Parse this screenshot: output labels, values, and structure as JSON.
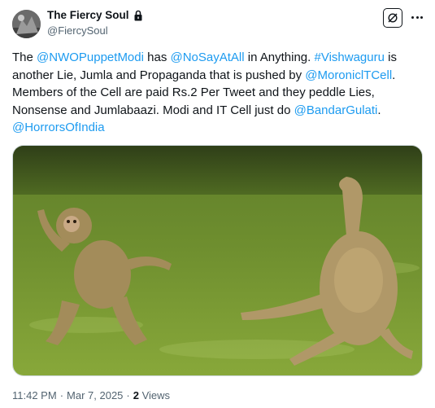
{
  "author": {
    "display_name": "The Fiercy Soul",
    "handle": "@FiercySoul",
    "avatar_icon": "avatar-photo",
    "protected_icon": "lock-icon"
  },
  "header_actions": {
    "grok_icon": "grok-icon",
    "more_icon": "more-options-icon"
  },
  "tweet": {
    "segments": [
      {
        "text": "The ",
        "type": "text"
      },
      {
        "text": "@NWOPuppetModi",
        "type": "link"
      },
      {
        "text": " has ",
        "type": "text"
      },
      {
        "text": "@NoSayAtAll",
        "type": "link"
      },
      {
        "text": " in Anything. ",
        "type": "text"
      },
      {
        "text": "#Vishwaguru",
        "type": "link"
      },
      {
        "text": " is another Lie, Jumla and Propaganda that is pushed by ",
        "type": "text"
      },
      {
        "text": "@MoroniclTCell",
        "type": "link"
      },
      {
        "text": ". Members of the Cell are paid Rs.2 Per Tweet  and they peddle Lies, Nonsense and Jumlabaazi. Modi and IT Cell just do ",
        "type": "text"
      },
      {
        "text": "@BandarGulati",
        "type": "link"
      },
      {
        "text": ". ",
        "type": "text"
      },
      {
        "text": "@HorrorsOfIndia",
        "type": "link"
      }
    ]
  },
  "media": {
    "description_icon": "photo-two-monkeys-on-grass"
  },
  "meta": {
    "time": "11:42 PM",
    "sep1": "·",
    "date": "Mar 7, 2025",
    "sep2": "·",
    "views_count": "2",
    "views_label": "Views"
  },
  "colors": {
    "link": "#1d9bf0",
    "text": "#0f1419",
    "muted": "#536471",
    "border": "#cfd9de"
  }
}
